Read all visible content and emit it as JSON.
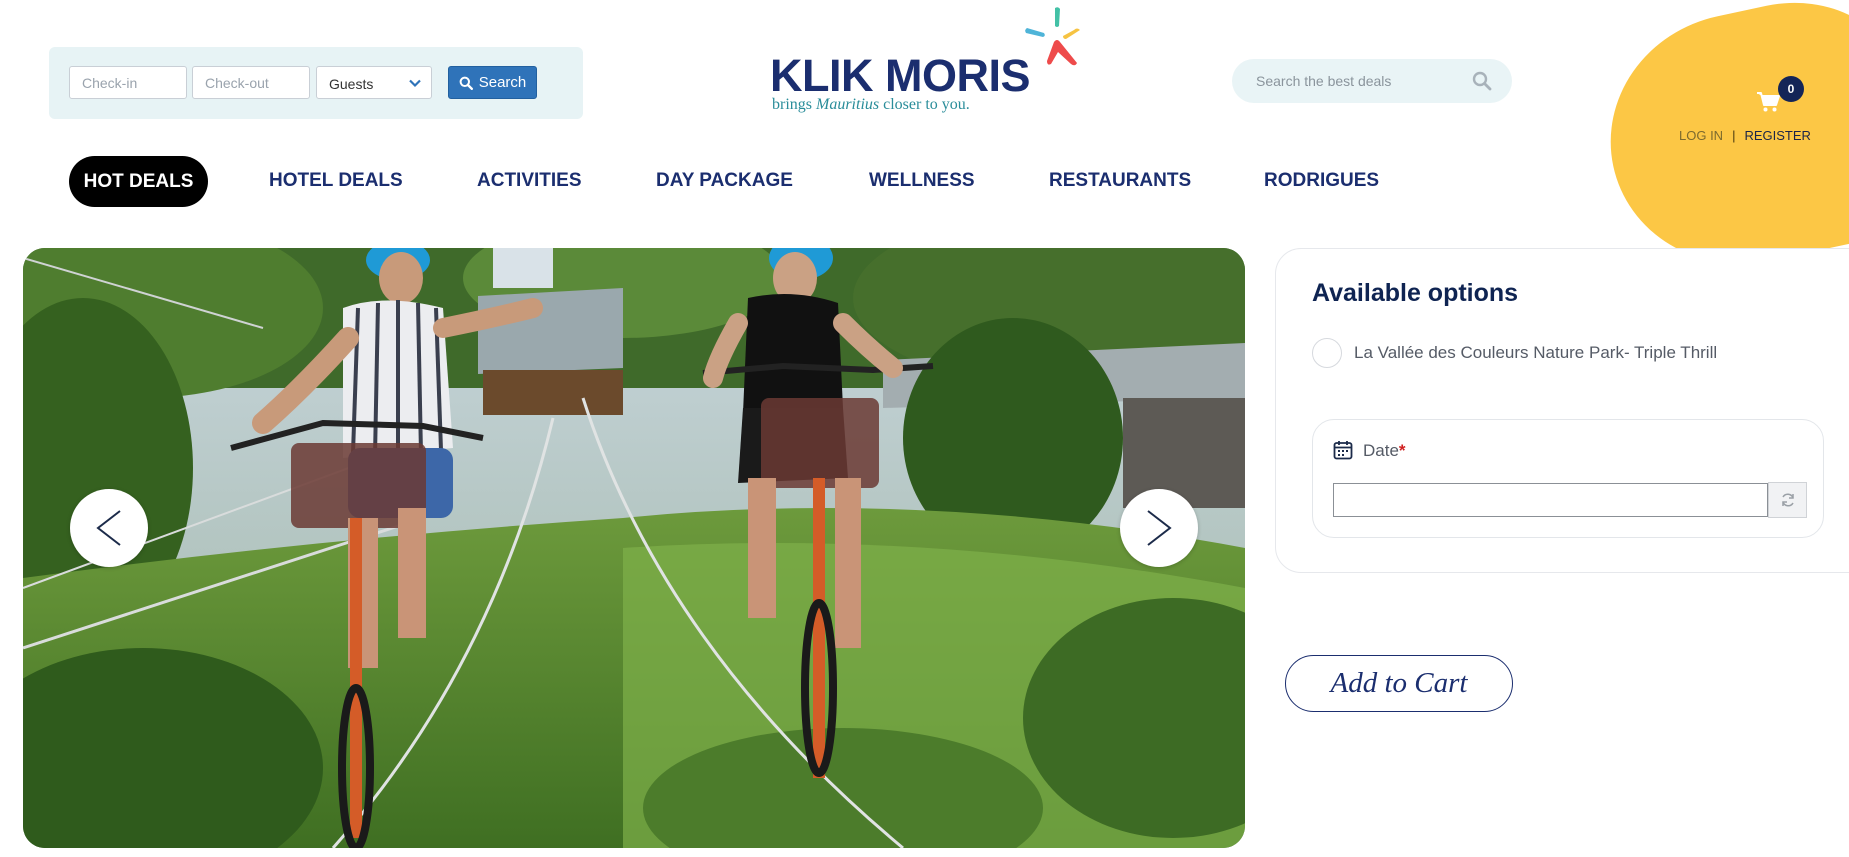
{
  "booking": {
    "checkin_placeholder": "Check-in",
    "checkout_placeholder": "Check-out",
    "guests_value": "Guests",
    "search_label": "Search"
  },
  "logo": {
    "wordmark": "KLIK MORIS",
    "tagline_pre": "brings ",
    "tagline_em": "Mauritius",
    "tagline_post": " closer to you."
  },
  "deal_search": {
    "placeholder": "Search the best deals",
    "icon": "magnifier-icon"
  },
  "account": {
    "cart_count": "0",
    "login_label": "LOG IN",
    "separator": "|",
    "register_label": "REGISTER",
    "accent_color": "#fcc745"
  },
  "nav": {
    "items": [
      {
        "label": "HOT DEALS",
        "active": true
      },
      {
        "label": "HOTEL DEALS"
      },
      {
        "label": "ACTIVITIES"
      },
      {
        "label": "DAY PACKAGE"
      },
      {
        "label": "WELLNESS"
      },
      {
        "label": "RESTAURANTS"
      },
      {
        "label": "RODRIGUES"
      }
    ]
  },
  "hero": {
    "image_description_icon": "zipline-bicycle-photo",
    "prev_icon": "chevron-left-icon",
    "next_icon": "chevron-right-icon"
  },
  "options": {
    "title": "Available options",
    "option_label": "La Vallée des Couleurs Nature Park- Triple Thrill",
    "date_label": "Date",
    "required_mark": "*",
    "add_to_cart": "Add to Cart"
  },
  "colors": {
    "primary_navy": "#1b2e6f",
    "search_blue": "#2f73b9",
    "booking_bg": "#e7f3f5",
    "required_red": "#d01f1f"
  }
}
